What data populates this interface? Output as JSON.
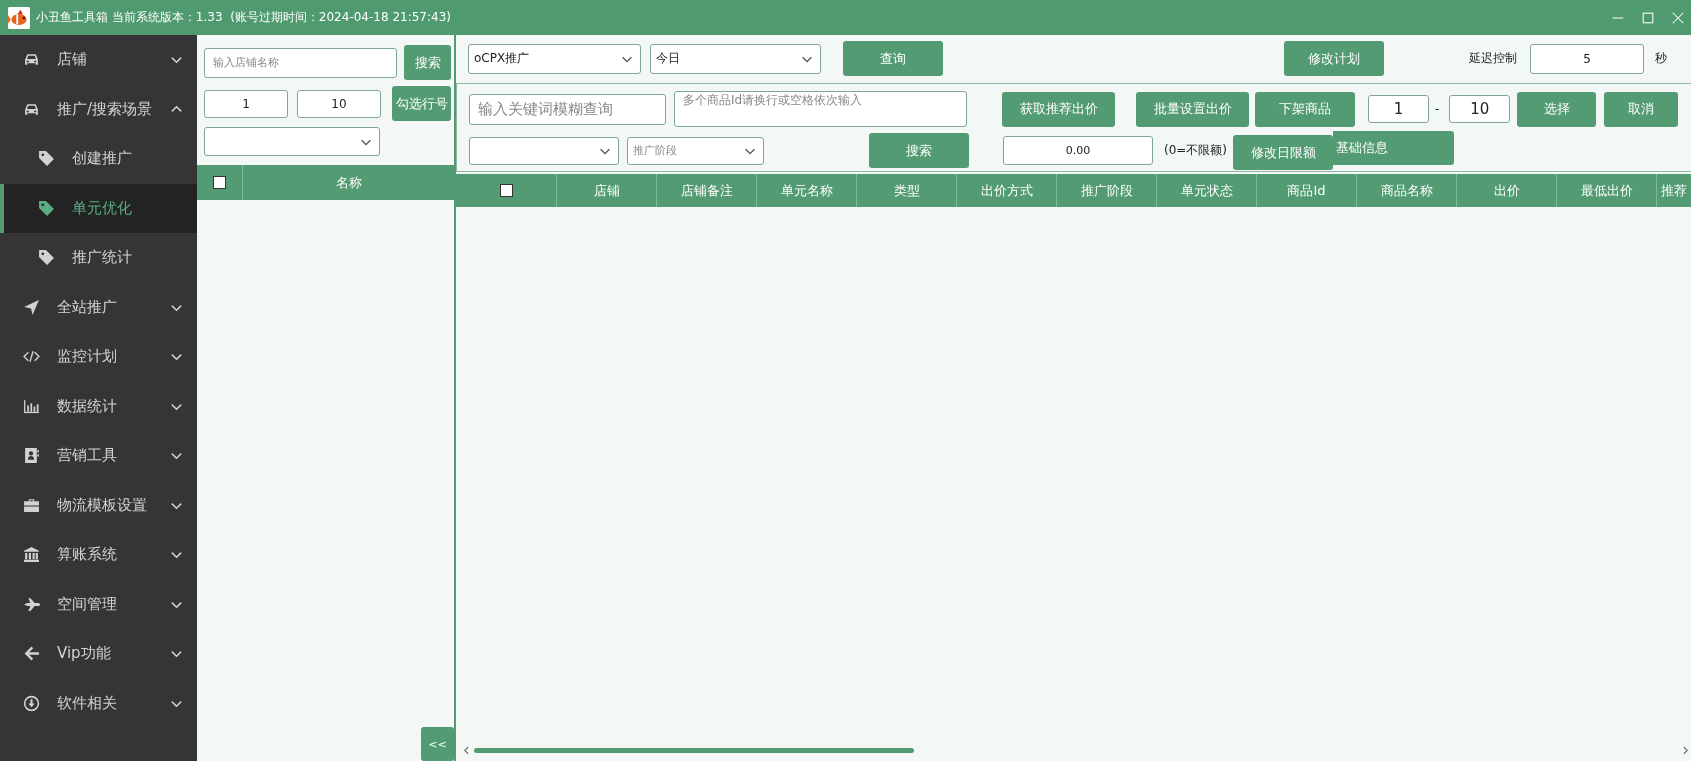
{
  "window": {
    "title": "小丑鱼工具箱 当前系统版本：1.33  (账号过期时间：2024-04-18 21:57:43)"
  },
  "sidebar": {
    "items": [
      {
        "label": "店铺",
        "expanded": false,
        "selected": false
      },
      {
        "label": "推广/搜索场景",
        "expanded": true,
        "selected": false,
        "children": [
          {
            "label": "创建推广",
            "selected": false
          },
          {
            "label": "单元优化",
            "selected": true
          },
          {
            "label": "推广统计",
            "selected": false
          }
        ]
      },
      {
        "label": "全站推广",
        "expanded": false,
        "selected": false
      },
      {
        "label": "监控计划",
        "expanded": false,
        "selected": false
      },
      {
        "label": "数据统计",
        "expanded": false,
        "selected": false
      },
      {
        "label": "营销工具",
        "expanded": false,
        "selected": false
      },
      {
        "label": "物流模板设置",
        "expanded": false,
        "selected": false
      },
      {
        "label": "算账系统",
        "expanded": false,
        "selected": false
      },
      {
        "label": "空间管理",
        "expanded": false,
        "selected": false
      },
      {
        "label": "Vip功能",
        "expanded": false,
        "selected": false
      },
      {
        "label": "软件相关",
        "expanded": false,
        "selected": false
      }
    ]
  },
  "shop_panel": {
    "search": {
      "placeholder": "输入店铺名称"
    },
    "search_button": "搜索",
    "row_from": "1",
    "row_to": "10",
    "select_rows_button": "勾选行号",
    "table": {
      "header_checked": false,
      "columns": [
        "名称"
      ]
    },
    "collapse_button": "<<"
  },
  "toolbar": {
    "plan_type": "oCPX推广",
    "date_range": "今日",
    "query_button": "查询",
    "modify_plan_button": "修改计划",
    "delay_label": "延迟控制",
    "delay_value": "5",
    "delay_unit": "秒"
  },
  "filters": {
    "keyword": {
      "placeholder": "输入关键词模糊查询"
    },
    "product_ids": {
      "placeholder": "多个商品Id请换行或空格依次输入"
    },
    "phase": {
      "placeholder": "推广阶段"
    },
    "search_button": "搜索",
    "fetch_bid_button": "获取推荐出价",
    "batch_bid_button": "批量设置出价",
    "delist_button": "下架商品",
    "range_from": "1",
    "range_separator": "-",
    "range_to": "10",
    "select_button": "选择",
    "cancel_button": "取消",
    "budget_value": "0.00",
    "budget_hint": "(0=不限额)",
    "modify_budget_button": "修改日限额",
    "base_info_button": "基础信息"
  },
  "table": {
    "header_checked": false,
    "columns": [
      "店铺",
      "店铺备注",
      "单元名称",
      "类型",
      "出价方式",
      "推广阶段",
      "单元状态",
      "商品Id",
      "商品名称",
      "出价",
      "最低出价",
      "推荐"
    ]
  }
}
